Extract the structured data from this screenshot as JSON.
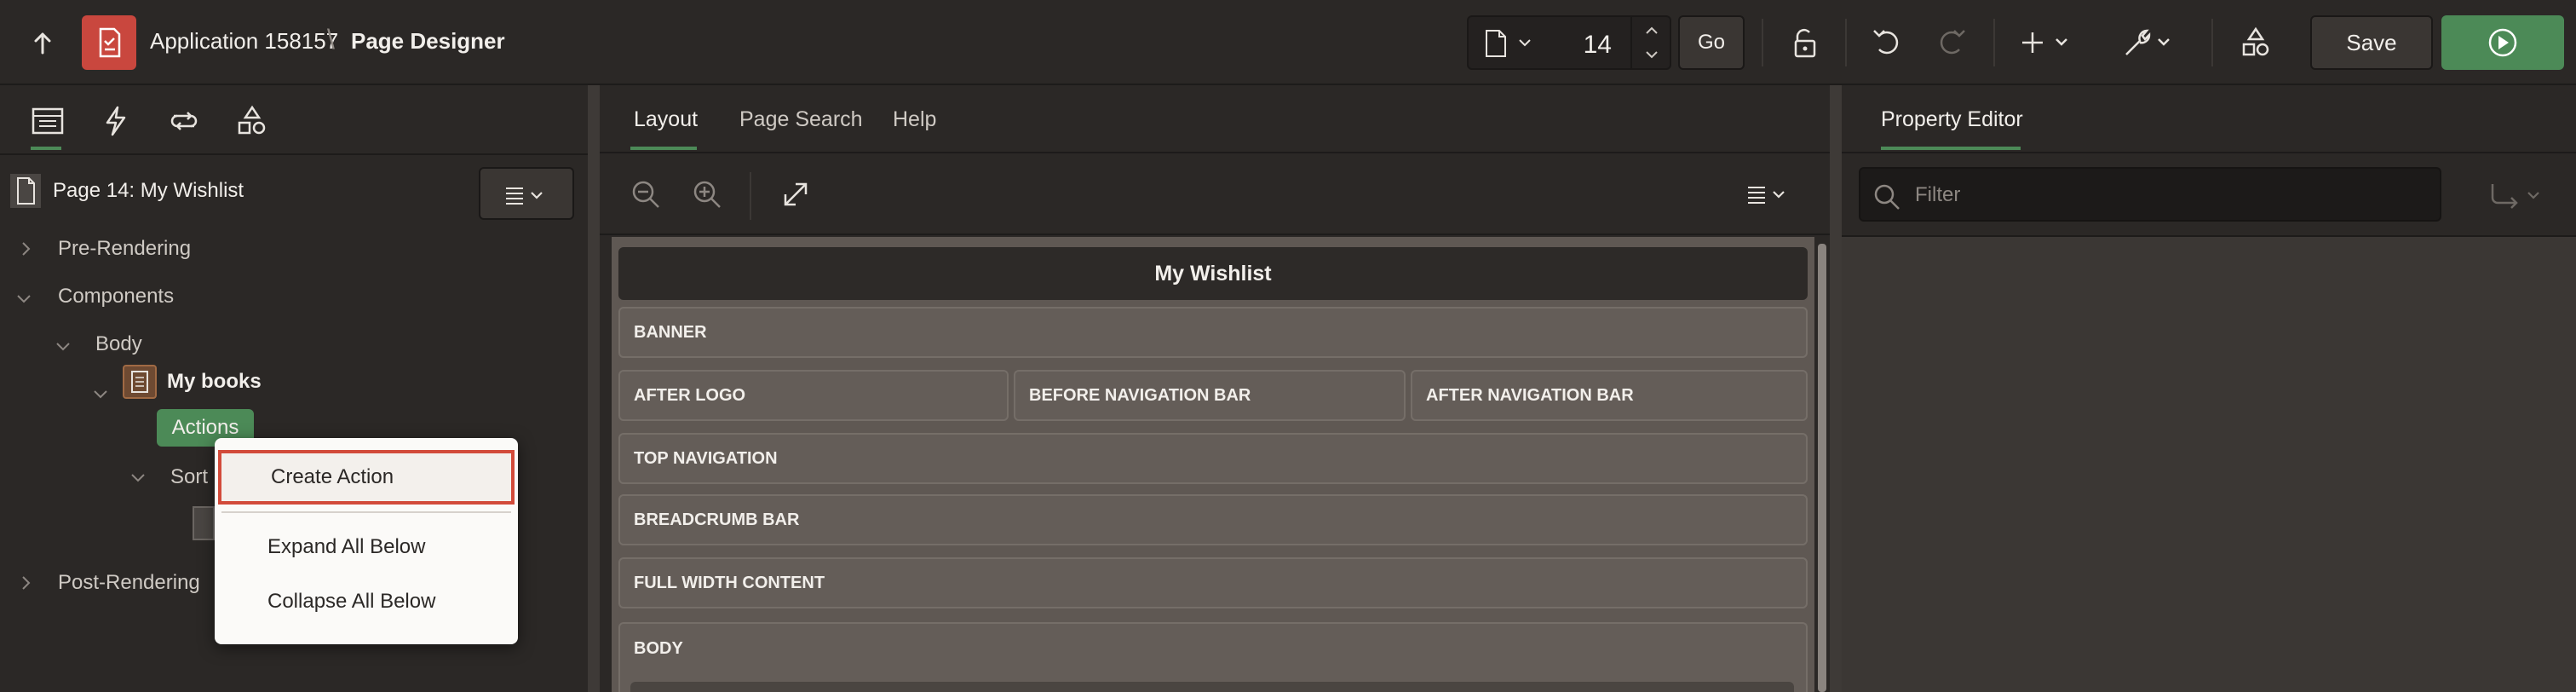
{
  "header": {
    "app_name": "Application 158157",
    "separator": "\\",
    "page_designer": "Page Designer",
    "page_number": "14",
    "go_label": "Go",
    "save_label": "Save"
  },
  "left_panel": {
    "tabs": [
      {
        "icon": "rendering-tree-icon",
        "active": true
      },
      {
        "icon": "dynamic-actions-icon"
      },
      {
        "icon": "processing-icon"
      },
      {
        "icon": "shared-components-icon"
      }
    ],
    "page_title": "Page 14: My Wishlist",
    "tree": {
      "pre_rendering": "Pre-Rendering",
      "components": "Components",
      "body": "Body",
      "region": "My books",
      "actions": "Actions",
      "sort": "Sort",
      "post_rendering": "Post-Rendering"
    }
  },
  "context_menu": {
    "items": [
      "Create Action",
      "Expand All Below",
      "Collapse All Below"
    ]
  },
  "center_panel": {
    "tabs": [
      "Layout",
      "Page Search",
      "Help"
    ],
    "grid_title": "My Wishlist",
    "slots": {
      "banner": "BANNER",
      "after_logo": "AFTER LOGO",
      "before_nav": "BEFORE NAVIGATION BAR",
      "after_nav": "AFTER NAVIGATION BAR",
      "top_nav": "TOP NAVIGATION",
      "breadcrumb": "BREADCRUMB BAR",
      "full_width": "FULL WIDTH CONTENT",
      "body": "BODY"
    }
  },
  "right_panel": {
    "tab": "Property Editor",
    "filter_placeholder": "Filter"
  },
  "colors": {
    "accent_green": "#4c8a57",
    "app_icon_red": "#c9473e",
    "menu_highlight": "#d24b3a"
  }
}
